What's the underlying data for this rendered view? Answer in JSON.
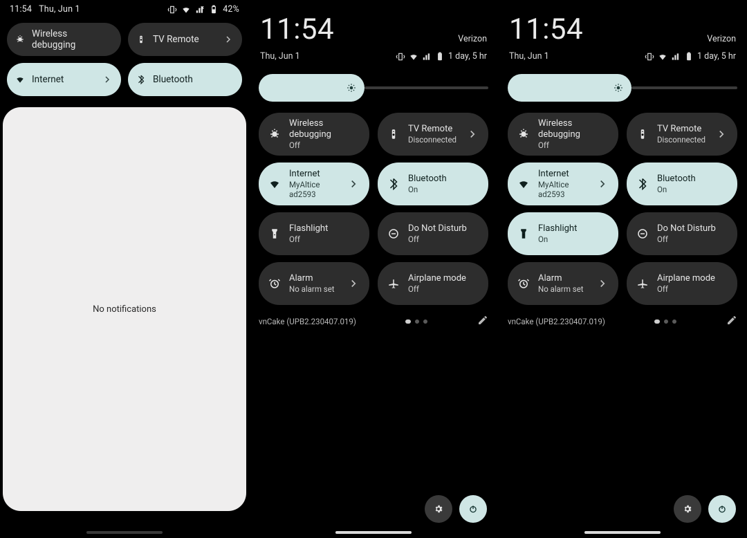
{
  "panel1": {
    "status": {
      "time": "11:54",
      "date": "Thu, Jun 1",
      "battery_pct": "42%"
    },
    "tiles": [
      {
        "name": "wireless-debugging",
        "label": "Wireless debugging",
        "on": false,
        "chevron": false
      },
      {
        "name": "tv-remote",
        "label": "TV Remote",
        "on": false,
        "chevron": true
      },
      {
        "name": "internet",
        "label": "Internet",
        "on": true,
        "chevron": true
      },
      {
        "name": "bluetooth",
        "label": "Bluetooth",
        "on": true,
        "chevron": false
      }
    ],
    "no_notifications": "No notifications"
  },
  "panel2": {
    "status": {
      "clock": "11:54",
      "carrier": "Verizon",
      "date": "Thu, Jun 1",
      "battery_text": "1 day, 5 hr"
    },
    "tiles": [
      {
        "name": "wireless-debugging",
        "label": "Wireless debugging",
        "sub": "Off",
        "on": false,
        "chevron": false
      },
      {
        "name": "tv-remote",
        "label": "TV Remote",
        "sub": "Disconnected",
        "on": false,
        "chevron": true
      },
      {
        "name": "internet",
        "label": "Internet",
        "sub": "MyAltice ad2593",
        "on": true,
        "chevron": true
      },
      {
        "name": "bluetooth",
        "label": "Bluetooth",
        "sub": "On",
        "on": true,
        "chevron": false
      },
      {
        "name": "flashlight",
        "label": "Flashlight",
        "sub": "Off",
        "on": false,
        "chevron": false
      },
      {
        "name": "dnd",
        "label": "Do Not Disturb",
        "sub": "Off",
        "on": false,
        "chevron": false
      },
      {
        "name": "alarm",
        "label": "Alarm",
        "sub": "No alarm set",
        "on": false,
        "chevron": true
      },
      {
        "name": "airplane",
        "label": "Airplane mode",
        "sub": "Off",
        "on": false,
        "chevron": false
      }
    ],
    "build": "vnCake (UPB2.230407.019)"
  },
  "panel3": {
    "status": {
      "clock": "11:54",
      "carrier": "Verizon",
      "date": "Thu, Jun 1",
      "battery_text": "1 day, 5 hr"
    },
    "tiles": [
      {
        "name": "wireless-debugging",
        "label": "Wireless debugging",
        "sub": "Off",
        "on": false,
        "chevron": false
      },
      {
        "name": "tv-remote",
        "label": "TV Remote",
        "sub": "Disconnected",
        "on": false,
        "chevron": true
      },
      {
        "name": "internet",
        "label": "Internet",
        "sub": "MyAltice ad2593",
        "on": true,
        "chevron": true
      },
      {
        "name": "bluetooth",
        "label": "Bluetooth",
        "sub": "On",
        "on": true,
        "chevron": false
      },
      {
        "name": "flashlight",
        "label": "Flashlight",
        "sub": "On",
        "on": true,
        "chevron": false
      },
      {
        "name": "dnd",
        "label": "Do Not Disturb",
        "sub": "Off",
        "on": false,
        "chevron": false
      },
      {
        "name": "alarm",
        "label": "Alarm",
        "sub": "No alarm set",
        "on": false,
        "chevron": true
      },
      {
        "name": "airplane",
        "label": "Airplane mode",
        "sub": "Off",
        "on": false,
        "chevron": false
      }
    ],
    "build": "vnCake (UPB2.230407.019)"
  }
}
